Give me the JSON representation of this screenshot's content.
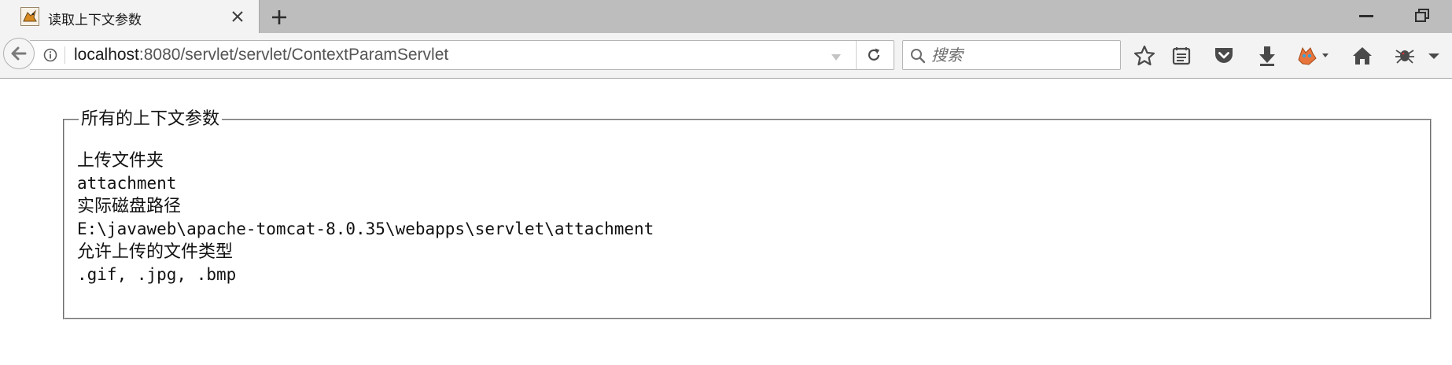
{
  "tab": {
    "title": "读取上下文参数",
    "favicon": "tomcat-icon"
  },
  "window_controls": [
    "minimize-icon",
    "restore-icon"
  ],
  "navbar": {
    "url_host": "localhost",
    "url_path": ":8080/servlet/servlet/ContextParamServlet",
    "search_placeholder": "搜索"
  },
  "toolbar_icons": [
    "bookmark-star-icon",
    "reading-list-icon",
    "pocket-icon",
    "download-icon",
    "firefox-extension-icon",
    "home-icon",
    "bug-extension-icon",
    "overflow-menu-icon"
  ],
  "page": {
    "legend": "所有的上下文参数",
    "params": [
      {
        "name": "上传文件夹",
        "value": "attachment"
      },
      {
        "name": "实际磁盘路径",
        "value": "E:\\javaweb\\apache-tomcat-8.0.35\\webapps\\servlet\\attachment"
      },
      {
        "name": "允许上传的文件类型",
        "value": ".gif, .jpg, .bmp"
      }
    ]
  },
  "colors": {
    "tabstrip_bg": "#bdbdbd",
    "toolbar_bg": "#f3f3f3",
    "icon_gray": "#4a4a4a",
    "url_path_gray": "#555555"
  }
}
